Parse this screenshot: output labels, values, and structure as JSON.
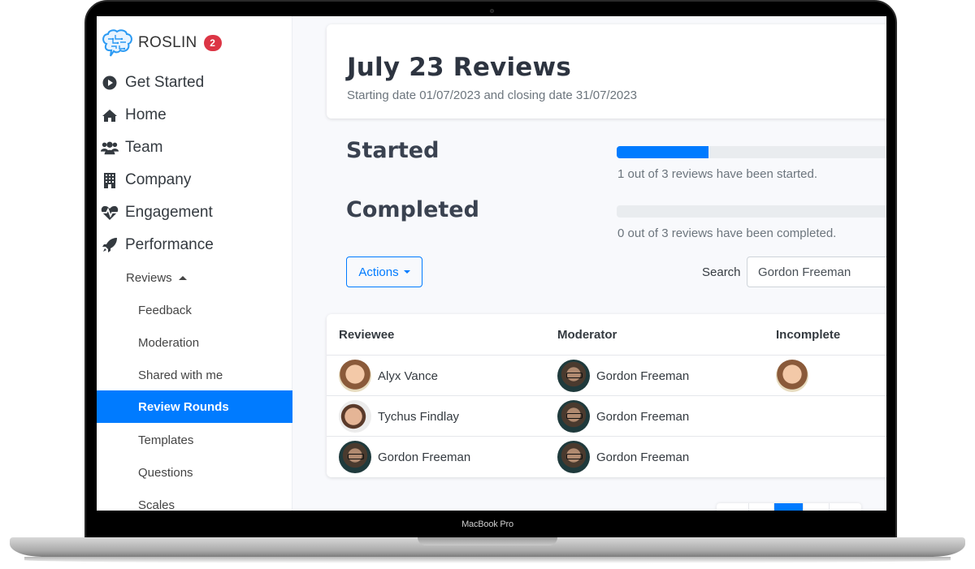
{
  "device": {
    "model_label": "MacBook Pro"
  },
  "sidebar": {
    "brand": {
      "name": "ROSLIN",
      "badge_count": "2",
      "logo_icon": "brain-icon"
    },
    "nav": [
      {
        "label": "Get Started",
        "icon": "play-circle-icon"
      },
      {
        "label": "Home",
        "icon": "home-icon"
      },
      {
        "label": "Team",
        "icon": "users-icon"
      },
      {
        "label": "Company",
        "icon": "building-icon"
      },
      {
        "label": "Engagement",
        "icon": "heartbeat-icon"
      },
      {
        "label": "Performance",
        "icon": "rocket-icon"
      }
    ],
    "reviews": {
      "label": "Reviews",
      "expanded": true
    },
    "sub_items": [
      {
        "label": "Feedback",
        "active": false
      },
      {
        "label": "Moderation",
        "active": false
      },
      {
        "label": "Shared with me",
        "active": false
      },
      {
        "label": "Review Rounds",
        "active": true
      },
      {
        "label": "Templates",
        "active": false
      },
      {
        "label": "Questions",
        "active": false
      },
      {
        "label": "Scales",
        "active": false
      }
    ]
  },
  "header": {
    "title": "July 23 Reviews",
    "subtitle": "Starting date 01/07/2023 and closing date 31/07/2023"
  },
  "stats": {
    "started": {
      "label": "Started",
      "count": 1,
      "total": 3,
      "fraction": 0.3333,
      "text": "1 out of 3 reviews have been started."
    },
    "completed": {
      "label": "Completed",
      "count": 0,
      "total": 3,
      "fraction": 0,
      "text": "0 out of 3 reviews have been completed."
    }
  },
  "toolbar": {
    "actions_label": "Actions",
    "search_label": "Search",
    "search_value": "Gordon Freeman"
  },
  "table": {
    "columns": [
      "Reviewee",
      "Moderator",
      "Incomplete"
    ],
    "rows": [
      {
        "reviewee": "Alyx Vance",
        "reviewee_avatar": "female-avatar",
        "moderator": "Gordon Freeman",
        "moderator_avatar": "gordon-avatar",
        "incomplete_avatars": [
          "female-avatar"
        ]
      },
      {
        "reviewee": "Tychus Findlay",
        "reviewee_avatar": "male-avatar",
        "moderator": "Gordon Freeman",
        "moderator_avatar": "gordon-avatar",
        "incomplete_avatars": []
      },
      {
        "reviewee": "Gordon Freeman",
        "reviewee_avatar": "gordon-avatar",
        "moderator": "Gordon Freeman",
        "moderator_avatar": "gordon-avatar",
        "incomplete_avatars": []
      }
    ]
  },
  "pagination": {
    "active_page_index": 2,
    "colors": {
      "active": "#007bff"
    }
  },
  "colors": {
    "accent": "#007bff",
    "badge": "#dc3545",
    "track": "#e9ecef"
  }
}
